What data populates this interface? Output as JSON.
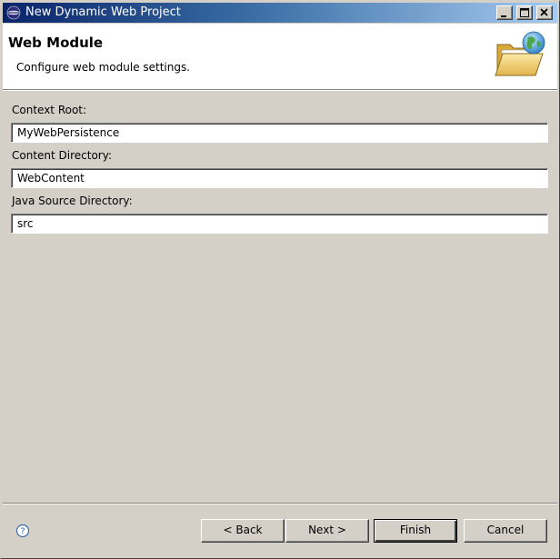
{
  "window": {
    "title": "New Dynamic Web Project",
    "controls": {
      "minimize_icon": "minimize-icon",
      "maximize_icon": "maximize-icon",
      "close_icon": "close-icon"
    }
  },
  "banner": {
    "title": "Web Module",
    "description": "Configure web module settings.",
    "icon": "web-folder-globe-icon"
  },
  "form": {
    "context_root": {
      "label": "Context Root:",
      "value": "MyWebPersistence"
    },
    "content_directory": {
      "label": "Content Directory:",
      "value": "WebContent"
    },
    "java_source_directory": {
      "label": "Java Source Directory:",
      "value": "src"
    }
  },
  "buttons": {
    "help_icon": "help-icon",
    "back": "< Back",
    "next": "Next >",
    "finish": "Finish",
    "cancel": "Cancel"
  },
  "colors": {
    "titlebar_start": "#0a246a",
    "titlebar_end": "#a6caf0",
    "dialog_background": "#d4d0c8",
    "banner_background": "#ffffff"
  }
}
